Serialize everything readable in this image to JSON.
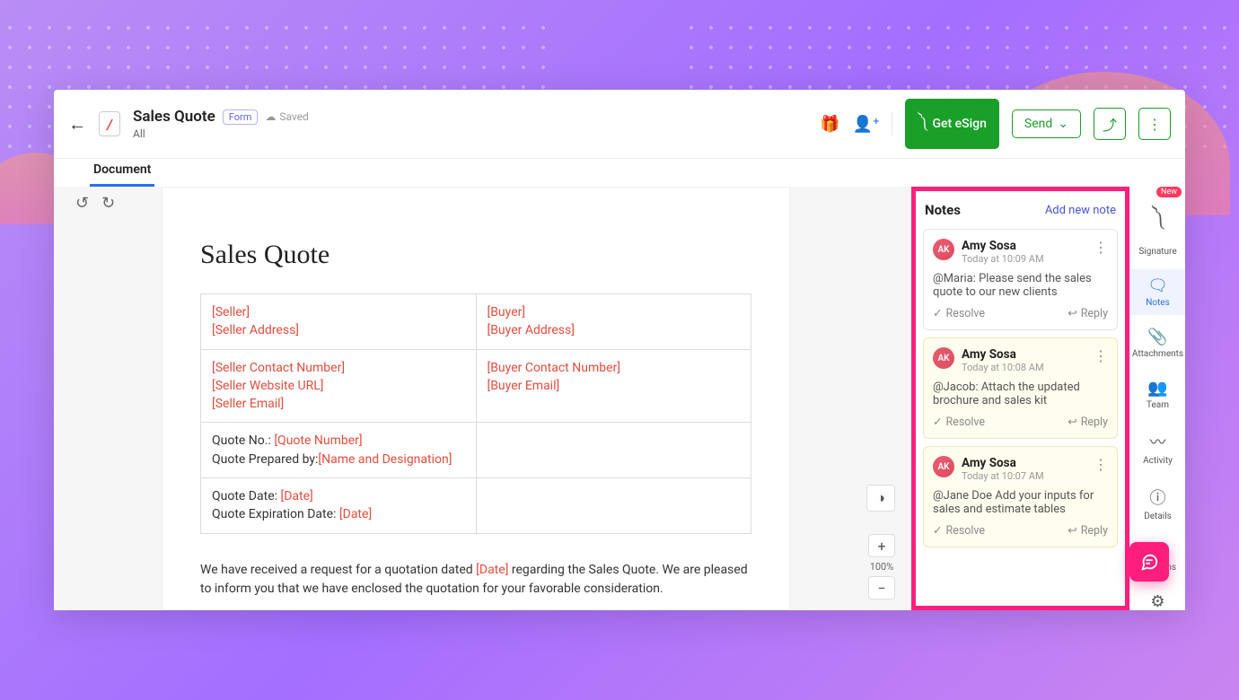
{
  "header": {
    "title": "Sales Quote",
    "badge": "Form",
    "saved": "Saved",
    "subtitle": "All",
    "tab": "Document",
    "esign_button": "Get eSign",
    "send_button": "Send"
  },
  "document": {
    "heading": "Sales Quote",
    "placeholders": {
      "seller": "[Seller]",
      "seller_address": "[Seller Address]",
      "buyer": "[Buyer]",
      "buyer_address": "[Buyer Address]",
      "seller_contact": "[Seller Contact Number]",
      "seller_url": "[Seller Website URL]",
      "seller_email": "[Seller Email]",
      "buyer_contact": "[Buyer Contact Number]",
      "buyer_email": "[Buyer Email]",
      "quote_no": "[Quote Number]",
      "name_desig": "[Name and Designation]",
      "quote_date": "[Date]",
      "exp_date": "[Date]",
      "body_date": "[Date]"
    },
    "labels": {
      "quote_no": "Quote No.: ",
      "prepared_by": "Quote Prepared by:",
      "quote_date": "Quote Date: ",
      "exp_date": "Quote Expiration Date: "
    },
    "body_pre": "We have received a request for a quotation dated ",
    "body_post": " regarding the Sales Quote. We are pleased to inform you that we have enclosed the quotation for your favorable consideration."
  },
  "zoom": {
    "percent": "100%"
  },
  "notes_panel": {
    "title": "Notes",
    "add_label": "Add new note",
    "resolve_label": "Resolve",
    "reply_label": "Reply",
    "items": [
      {
        "author": "Amy Sosa",
        "initials": "AK",
        "time": "Today at 10:09 AM",
        "body": "@Maria: Please send the sales quote to our new clients",
        "highlighted": false
      },
      {
        "author": "Amy Sosa",
        "initials": "AK",
        "time": "Today at 10:08 AM",
        "body": "@Jacob: Attach the updated brochure and sales kit",
        "highlighted": true
      },
      {
        "author": "Amy Sosa",
        "initials": "AK",
        "time": "Today at 10:07 AM",
        "body": "@Jane Doe Add your inputs for sales and estimate tables",
        "highlighted": true
      }
    ]
  },
  "rail": {
    "new_pill": "New",
    "items": [
      {
        "label": "Signature"
      },
      {
        "label": "Notes"
      },
      {
        "label": "Attachments"
      },
      {
        "label": "Team"
      },
      {
        "label": "Activity"
      },
      {
        "label": "Details"
      },
      {
        "label": "Metalens"
      },
      {
        "label": "Settings"
      }
    ]
  }
}
